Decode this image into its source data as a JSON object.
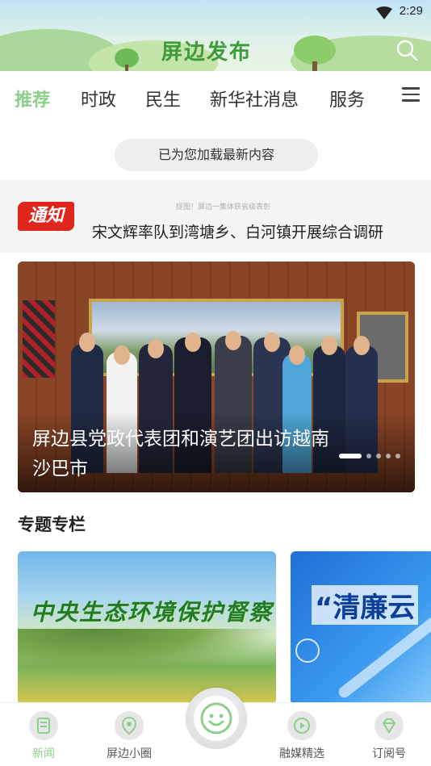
{
  "status_bar": {
    "time": "2:29"
  },
  "header": {
    "logo_text": "屏边发布"
  },
  "tabs": [
    {
      "label": "推荐",
      "active": true
    },
    {
      "label": "时政"
    },
    {
      "label": "民生"
    },
    {
      "label": "新华社消息"
    },
    {
      "label": "服务"
    }
  ],
  "refresh_notice": "已为您加载最新内容",
  "notice": {
    "badge": "通知",
    "small_text": "捉图！屏边一集体获省级表彰",
    "headline": "宋文辉率队到湾塘乡、白河镇开展综合调研"
  },
  "carousel": {
    "caption": "屏边县党政代表团和演艺团出访越南沙巴市",
    "slide_count": 5,
    "active_slide": 1
  },
  "section": {
    "title": "专题专栏",
    "cards": [
      {
        "title": "中央生态环境保护督察"
      },
      {
        "title": "“清廉云"
      }
    ]
  },
  "bottom_nav": [
    {
      "label": "新闻",
      "icon": "news-icon",
      "active": true
    },
    {
      "label": "屏边小圈",
      "icon": "location-icon"
    },
    {
      "label": "",
      "icon": "smiley-icon"
    },
    {
      "label": "融媒精选",
      "icon": "play-icon"
    },
    {
      "label": "订阅号",
      "icon": "diamond-icon"
    }
  ],
  "colors": {
    "accent_green": "#8bcf8a",
    "logo_green": "#3f9a3b",
    "notice_red": "#e0261c"
  }
}
